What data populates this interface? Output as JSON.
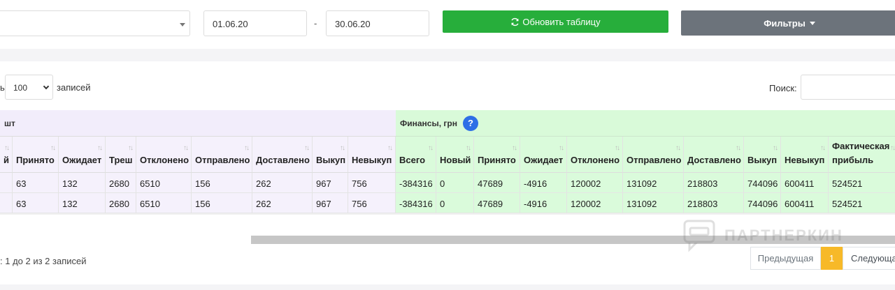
{
  "toolbar": {
    "date_from": "01.06.20",
    "date_separator": "-",
    "date_to": "30.06.20",
    "refresh_label": "Обновить таблицу",
    "filters_label": "Фильтры",
    "refresh_color": "#27ae3b",
    "filters_color": "#6c737b"
  },
  "table_controls": {
    "show_prefix": "ь",
    "page_length": "100",
    "records_label": "записей",
    "search_label": "Поиск:"
  },
  "table": {
    "group_counts_label": "шт",
    "group_finance_label": "Финансы, грн",
    "help_label": "?",
    "count_headers": [
      "й",
      "Принято",
      "Ожидает",
      "Треш",
      "Отклонено",
      "Отправлено",
      "Доставлено",
      "Выкуп",
      "Невыкуп"
    ],
    "finance_headers": [
      "Всего",
      "Новый",
      "Принято",
      "Ожидает",
      "Отклонено",
      "Отправлено",
      "Доставлено",
      "Выкуп",
      "Невыкуп",
      "Фактическая прибыль"
    ],
    "rows": [
      {
        "counts": [
          "",
          "63",
          "132",
          "2680",
          "6510",
          "156",
          "262",
          "967",
          "756"
        ],
        "finance": [
          "-384316",
          "0",
          "47689",
          "-4916",
          "120002",
          "131092",
          "218803",
          "744096",
          "600411",
          "524521"
        ]
      },
      {
        "counts": [
          "",
          "63",
          "132",
          "2680",
          "6510",
          "156",
          "262",
          "967",
          "756"
        ],
        "finance": [
          "-384316",
          "0",
          "47689",
          "-4916",
          "120002",
          "131092",
          "218803",
          "744096",
          "600411",
          "524521"
        ]
      }
    ]
  },
  "footer": {
    "info": ": 1 до 2 из 2 записей",
    "prev_label": "Предыдущая",
    "current_page": "1",
    "next_label": "Следующа"
  },
  "watermark": {
    "text": "ПАРТНЕРКИН",
    "accent": "#f7b928"
  }
}
